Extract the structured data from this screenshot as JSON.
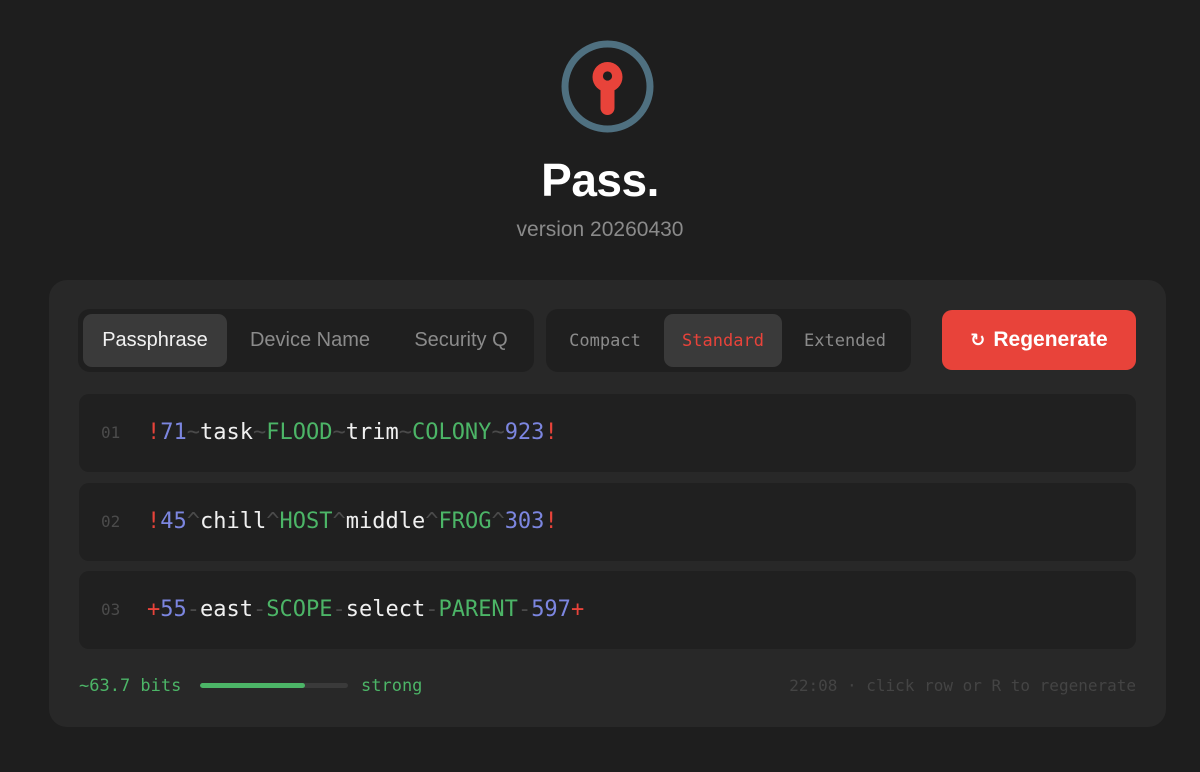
{
  "app": {
    "title": "Pass.",
    "version": "version 20260430"
  },
  "colors": {
    "background": "#1e1e1e",
    "card": "#282828",
    "accent": "#e8433a",
    "logo_ring": "#4f7080",
    "number": "#7c86e0",
    "caps_word": "#4cb567",
    "separator": "#4a4a4a"
  },
  "modes": {
    "items": [
      {
        "label": "Passphrase",
        "active": true
      },
      {
        "label": "Device Name",
        "active": false
      },
      {
        "label": "Security Q",
        "active": false
      }
    ]
  },
  "lengths": {
    "items": [
      {
        "label": "Compact",
        "active": false
      },
      {
        "label": "Standard",
        "active": true
      },
      {
        "label": "Extended",
        "active": false
      }
    ]
  },
  "regenerate": {
    "icon": "refresh-icon",
    "label": "Regenerate"
  },
  "passwords": [
    {
      "num": "01",
      "tokens": [
        {
          "t": "!",
          "k": "sym"
        },
        {
          "t": "71",
          "k": "num"
        },
        {
          "t": "~",
          "k": "sep"
        },
        {
          "t": "task",
          "k": "word"
        },
        {
          "t": "~",
          "k": "sep"
        },
        {
          "t": "FLOOD",
          "k": "caps"
        },
        {
          "t": "~",
          "k": "sep"
        },
        {
          "t": "trim",
          "k": "word"
        },
        {
          "t": "~",
          "k": "sep"
        },
        {
          "t": "COLONY",
          "k": "caps"
        },
        {
          "t": "~",
          "k": "sep"
        },
        {
          "t": "923",
          "k": "num"
        },
        {
          "t": "!",
          "k": "sym"
        }
      ]
    },
    {
      "num": "02",
      "tokens": [
        {
          "t": "!",
          "k": "sym"
        },
        {
          "t": "45",
          "k": "num"
        },
        {
          "t": "^",
          "k": "sep"
        },
        {
          "t": "chill",
          "k": "word"
        },
        {
          "t": "^",
          "k": "sep"
        },
        {
          "t": "HOST",
          "k": "caps"
        },
        {
          "t": "^",
          "k": "sep"
        },
        {
          "t": "middle",
          "k": "word"
        },
        {
          "t": "^",
          "k": "sep"
        },
        {
          "t": "FROG",
          "k": "caps"
        },
        {
          "t": "^",
          "k": "sep"
        },
        {
          "t": "303",
          "k": "num"
        },
        {
          "t": "!",
          "k": "sym"
        }
      ]
    },
    {
      "num": "03",
      "tokens": [
        {
          "t": "+",
          "k": "sym"
        },
        {
          "t": "55",
          "k": "num"
        },
        {
          "t": "-",
          "k": "sep"
        },
        {
          "t": "east",
          "k": "word"
        },
        {
          "t": "-",
          "k": "sep"
        },
        {
          "t": "SCOPE",
          "k": "caps"
        },
        {
          "t": "-",
          "k": "sep"
        },
        {
          "t": "select",
          "k": "word"
        },
        {
          "t": "-",
          "k": "sep"
        },
        {
          "t": "PARENT",
          "k": "caps"
        },
        {
          "t": "-",
          "k": "sep"
        },
        {
          "t": "597",
          "k": "num"
        },
        {
          "t": "+",
          "k": "sym"
        }
      ]
    }
  ],
  "footer": {
    "bits": "~63.7 bits",
    "strength_fraction": 0.71,
    "strength_label": "strong",
    "hint": "22:08 · click row or R to regenerate"
  }
}
